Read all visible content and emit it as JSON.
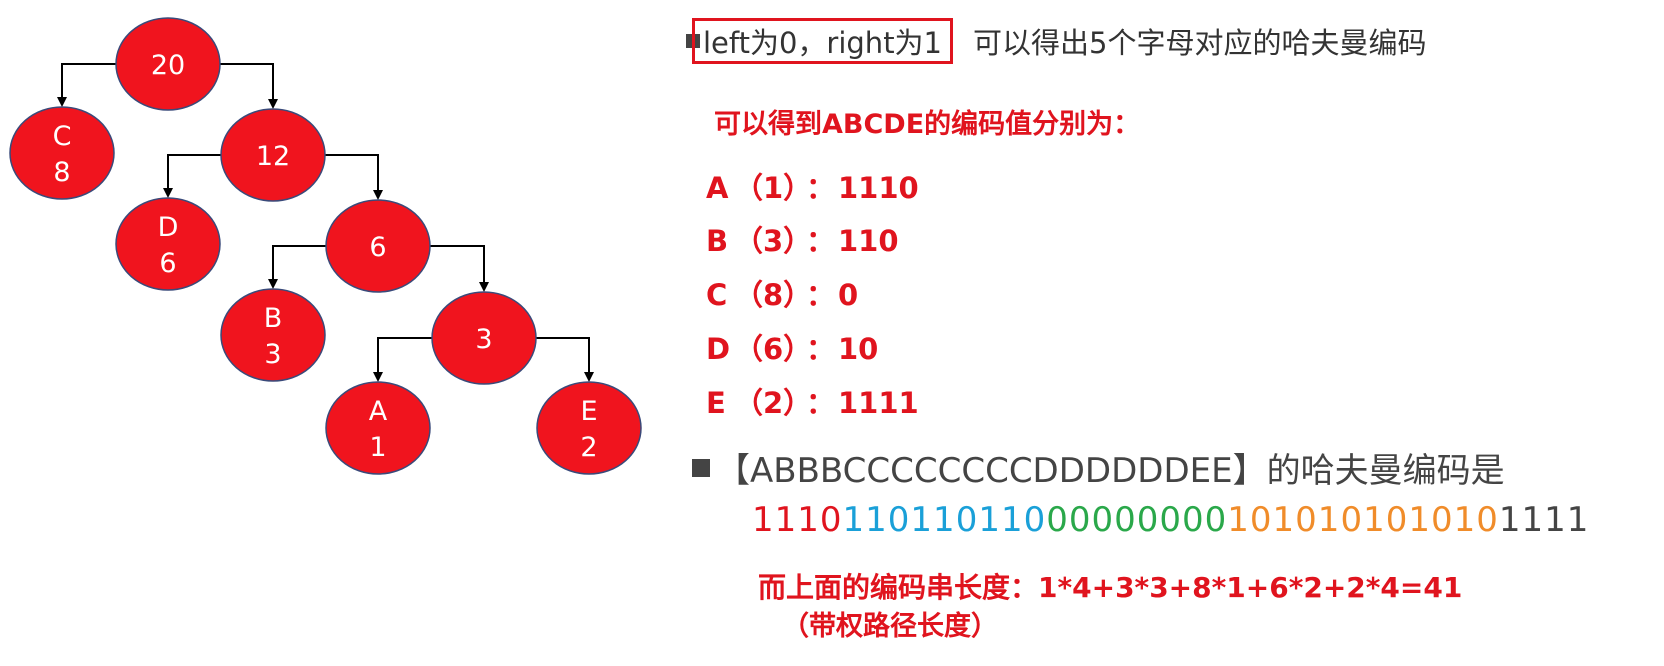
{
  "tree": {
    "nodes": [
      {
        "id": "n20",
        "lines": [
          "20"
        ]
      },
      {
        "id": "nC",
        "lines": [
          "C",
          "8"
        ]
      },
      {
        "id": "n12",
        "lines": [
          "12"
        ]
      },
      {
        "id": "nD",
        "lines": [
          "D",
          "6"
        ]
      },
      {
        "id": "n6",
        "lines": [
          "6"
        ]
      },
      {
        "id": "nB",
        "lines": [
          "B",
          "3"
        ]
      },
      {
        "id": "n3",
        "lines": [
          "3"
        ]
      },
      {
        "id": "nA",
        "lines": [
          "A",
          "1"
        ]
      },
      {
        "id": "nE",
        "lines": [
          "E",
          "2"
        ]
      }
    ]
  },
  "heading1": {
    "boxed": "left为0，right为1",
    "rest": "可以得出5个字母对应的哈夫曼编码"
  },
  "subheading": "可以得到ABCDE的编码值分别为：",
  "codes": [
    {
      "letter": "A",
      "weight": "（1）",
      "colon": "：",
      "code": "1110"
    },
    {
      "letter": "B",
      "weight": "（3）",
      "colon": "：",
      "code": "110"
    },
    {
      "letter": "C",
      "weight": "（8）",
      "colon": "：",
      "code": "0"
    },
    {
      "letter": "D",
      "weight": "（6）",
      "colon": "：",
      "code": "10"
    },
    {
      "letter": "E",
      "weight": "（2）",
      "colon": "：",
      "code": "1111"
    }
  ],
  "heading2": "【ABBBCCCCCCCCDDDDDDEE】的哈夫曼编码是",
  "bit_segments": [
    {
      "text": "1110",
      "color": "#e0141e"
    },
    {
      "text": "110110110",
      "color": "#1aa0d8"
    },
    {
      "text": "00000000",
      "color": "#2aa84a"
    },
    {
      "text": "101010101010",
      "color": "#f08c2a"
    },
    {
      "text": "1111",
      "color": "#444444"
    }
  ],
  "length_calc": "而上面的编码串长度：1*4+3*3+8*1+6*2+2*4=41",
  "length_note": "（带权路径长度）",
  "colors": {
    "node_fill": "#f0141e",
    "accent": "#e0141e"
  }
}
